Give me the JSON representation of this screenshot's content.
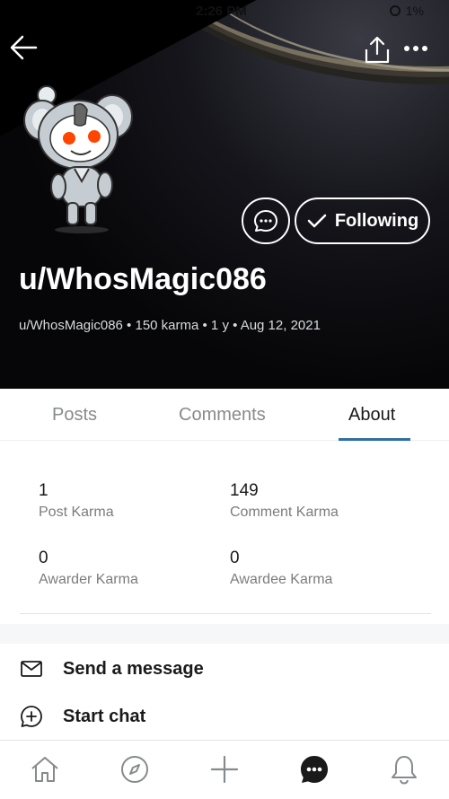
{
  "status_bar": {
    "time": "2:26 PM",
    "battery": "1%"
  },
  "header": {
    "username": "u/WhosMagic086",
    "meta": "u/WhosMagic086 • 150 karma • 1 y • Aug 12, 2021",
    "follow_label": "Following"
  },
  "tabs": [
    {
      "label": "Posts"
    },
    {
      "label": "Comments"
    },
    {
      "label": "About"
    }
  ],
  "stats": {
    "post_karma": {
      "value": "1",
      "label": "Post Karma"
    },
    "comment_karma": {
      "value": "149",
      "label": "Comment Karma"
    },
    "awarder_karma": {
      "value": "0",
      "label": "Awarder Karma"
    },
    "awardee_karma": {
      "value": "0",
      "label": "Awardee Karma"
    }
  },
  "actions": {
    "send_message": "Send a message",
    "start_chat": "Start chat"
  },
  "icons": [
    "back-arrow-icon",
    "share-icon",
    "more-icon",
    "chat-bubble-icon",
    "checkmark-icon",
    "mail-icon",
    "plus-circle-icon",
    "home-icon",
    "compass-icon",
    "plus-icon",
    "chat-icon",
    "bell-icon"
  ],
  "colors": {
    "accent": "#2f6fa3",
    "header_bg": "#060608",
    "text": "#1a1a1b",
    "muted": "#7c7c7c"
  }
}
